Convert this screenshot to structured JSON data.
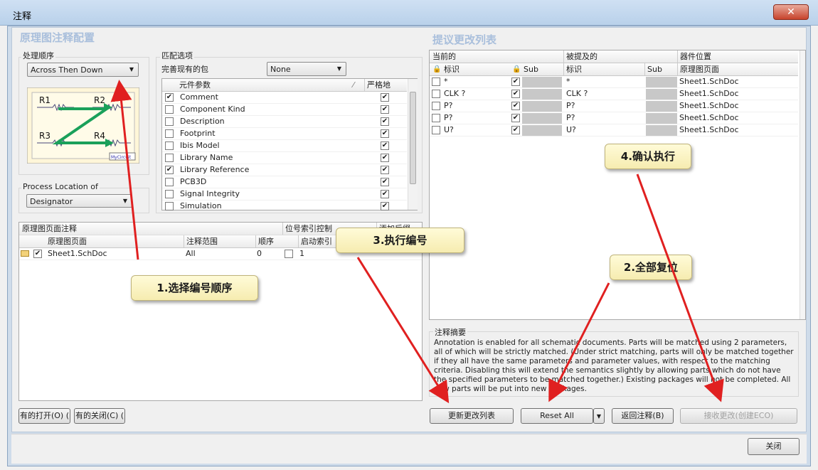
{
  "window": {
    "title": "注释",
    "close": "✕"
  },
  "left": {
    "section_title": "原理图注释配置",
    "order": {
      "label": "处理顺序",
      "value": "Across Then Down"
    },
    "diagram": {
      "r1": "R1",
      "r2": "R2",
      "r3": "R3",
      "r4": "R4",
      "logo": "MyCircuit"
    },
    "process_location": {
      "label": "Process Location of",
      "value": "Designator"
    },
    "match": {
      "label": "匹配选项",
      "complete_pkg_label": "完善现有的包",
      "complete_pkg_value": "None",
      "col_param": "元件参数",
      "col_strict": "严格地",
      "rows": [
        {
          "name": "Comment",
          "checked": "✔",
          "strict": "✔"
        },
        {
          "name": "Component Kind",
          "checked": "",
          "strict": "✔"
        },
        {
          "name": "Description",
          "checked": "",
          "strict": "✔"
        },
        {
          "name": "Footprint",
          "checked": "",
          "strict": "✔"
        },
        {
          "name": "Ibis Model",
          "checked": "",
          "strict": "✔"
        },
        {
          "name": "Library Name",
          "checked": "",
          "strict": "✔"
        },
        {
          "name": "Library Reference",
          "checked": "✔",
          "strict": "✔"
        },
        {
          "name": "PCB3D",
          "checked": "",
          "strict": "✔"
        },
        {
          "name": "Signal Integrity",
          "checked": "",
          "strict": "✔"
        },
        {
          "name": "Simulation",
          "checked": "",
          "strict": "✔"
        }
      ]
    },
    "sheets": {
      "group1": "原理图页面注释",
      "group2": "位号索引控制",
      "group3": "添加后缀",
      "col_sheet": "原理图页面",
      "col_scope": "注释范围",
      "col_order": "顺序",
      "col_start": "启动索引",
      "row": {
        "checked": "✔",
        "sheet": "Sheet1.SchDoc",
        "scope": "All",
        "order": "0",
        "start": "1"
      }
    },
    "btn_open": "有的打开(O) (",
    "btn_close": "有的关闭(C) ("
  },
  "right": {
    "section_title": "提议更改列表",
    "hdr_current": "当前的",
    "hdr_proposed": "被提及的",
    "hdr_location": "器件位置",
    "col_id": "标识",
    "col_sub": "Sub",
    "col_pid": "标识",
    "col_psub": "Sub",
    "col_sheet": "原理图页面",
    "rows": [
      {
        "cur": "*",
        "chk": "✔",
        "prop": "*",
        "sheet": "Sheet1.SchDoc"
      },
      {
        "cur": "CLK ?",
        "chk": "✔",
        "prop": "CLK ?",
        "sheet": "Sheet1.SchDoc"
      },
      {
        "cur": "P?",
        "chk": "✔",
        "prop": "P?",
        "sheet": "Sheet1.SchDoc"
      },
      {
        "cur": "P?",
        "chk": "✔",
        "prop": "P?",
        "sheet": "Sheet1.SchDoc"
      },
      {
        "cur": "U?",
        "chk": "✔",
        "prop": "U?",
        "sheet": "Sheet1.SchDoc"
      }
    ],
    "summary_label": "注释摘要",
    "summary_text": "Annotation is enabled for all schematic documents. Parts will be matched using 2 parameters, all of which will be strictly matched. (Under strict matching, parts will only be matched together if they all have the same parameters and parameter values, with respect to the matching criteria. Disabling this will extend the semantics slightly by allowing parts which do not have the specified parameters to be matched together.) Existing packages will not be completed. All new parts will be put into new packages.",
    "btn_update": "更新更改列表",
    "btn_reset": "Reset All",
    "btn_back": "返回注释(B)",
    "btn_accept": "接收更改(创建ECO)",
    "btn_close": "关闭"
  },
  "callouts": {
    "c1": "1.选择编号顺序",
    "c2": "2.全部复位",
    "c3": "3.执行编号",
    "c4": "4.确认执行"
  },
  "colors": {
    "arrow": "#e02020",
    "callout_bg": "#fbf3c4",
    "section_title": "#a9bfdc"
  }
}
